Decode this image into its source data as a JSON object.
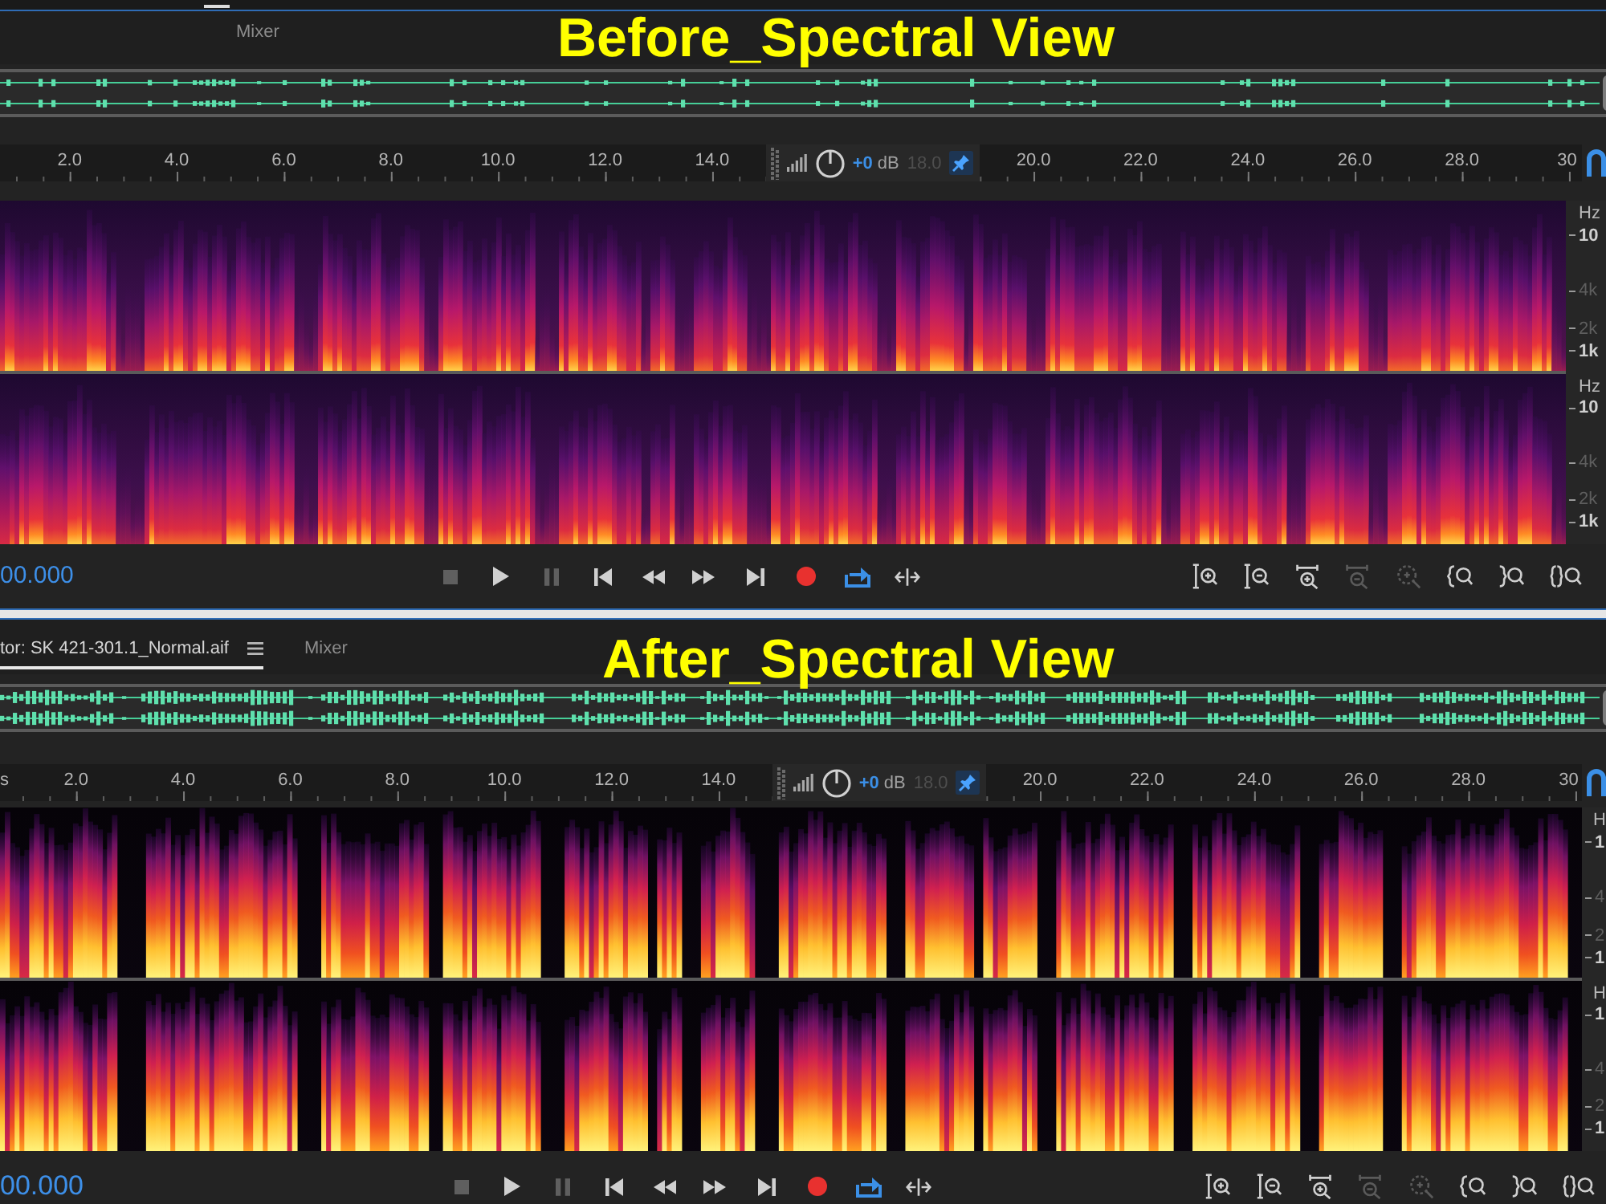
{
  "panels": [
    {
      "tabs": [
        {
          "label": "Mixer",
          "selected": false
        }
      ],
      "caption": "Before_Spectral View",
      "overview": {
        "kind": "faint"
      },
      "ruler": {
        "labels_before_hud": [
          "2.0",
          "4.0",
          "6.0",
          "8.0",
          "10.0",
          "12.0",
          "14.0"
        ],
        "hud": {
          "gain": "+0",
          "gain_unit": "dB",
          "covered_label": "18.0"
        },
        "labels_after_hud": [
          "20.0",
          "22.0",
          "24.0",
          "26.0",
          "28.0",
          "30"
        ]
      },
      "spectrogram": {
        "kind": "noisy",
        "channels": [
          {
            "unit": "Hz",
            "labels": [
              {
                "text": "10",
                "major": true
              },
              {
                "text": "4k",
                "major": false
              },
              {
                "text": "2k",
                "major": false
              },
              {
                "text": "1k",
                "major": true
              }
            ]
          },
          {
            "unit": "Hz",
            "labels": [
              {
                "text": "10",
                "major": true
              },
              {
                "text": "4k",
                "major": false
              },
              {
                "text": "2k",
                "major": false
              },
              {
                "text": "1k",
                "major": true
              }
            ]
          }
        ]
      },
      "transport": {
        "time": "00.000",
        "buttons": [
          {
            "kind": "stop",
            "disabled": true,
            "active": false
          },
          {
            "kind": "play",
            "disabled": false,
            "active": false
          },
          {
            "kind": "pause",
            "disabled": true,
            "active": false
          },
          {
            "kind": "to_start",
            "disabled": false,
            "active": false
          },
          {
            "kind": "rewind",
            "disabled": false,
            "active": false
          },
          {
            "kind": "fast_forward",
            "disabled": false,
            "active": false
          },
          {
            "kind": "to_end",
            "disabled": false,
            "active": false
          },
          {
            "kind": "record",
            "disabled": false,
            "active": false
          },
          {
            "kind": "loop",
            "disabled": false,
            "active": true
          },
          {
            "kind": "skip_selection",
            "disabled": false,
            "active": false
          }
        ],
        "zoom_buttons": [
          {
            "kind": "amp_in",
            "disabled": false
          },
          {
            "kind": "amp_out",
            "disabled": false
          },
          {
            "kind": "time_in",
            "disabled": false
          },
          {
            "kind": "time_out",
            "disabled": true
          },
          {
            "kind": "selection",
            "disabled": true
          },
          {
            "kind": "in_left",
            "disabled": false
          },
          {
            "kind": "in_right",
            "disabled": false
          },
          {
            "kind": "full",
            "disabled": false
          }
        ]
      }
    },
    {
      "tabs": [
        {
          "label": "tor: SK 421-301.1_Normal.aif",
          "selected": true
        },
        {
          "label": "Mixer",
          "selected": false
        }
      ],
      "caption": "After_Spectral View",
      "overview": {
        "kind": "dense"
      },
      "ruler": {
        "start_label": "s",
        "labels_before_hud": [
          "2.0",
          "4.0",
          "6.0",
          "8.0",
          "10.0",
          "12.0",
          "14.0"
        ],
        "hud": {
          "gain": "+0",
          "gain_unit": "dB",
          "covered_label": "18.0"
        },
        "labels_after_hud": [
          "20.0",
          "22.0",
          "24.0",
          "26.0",
          "28.0",
          "30"
        ]
      },
      "spectrogram": {
        "kind": "clean",
        "channels": [
          {
            "unit": "H",
            "labels": [
              {
                "text": "1",
                "major": true
              },
              {
                "text": "4",
                "major": false
              },
              {
                "text": "2",
                "major": false
              },
              {
                "text": "1",
                "major": true
              }
            ]
          },
          {
            "unit": "H",
            "labels": [
              {
                "text": "1",
                "major": true
              },
              {
                "text": "4",
                "major": false
              },
              {
                "text": "2",
                "major": false
              },
              {
                "text": "1",
                "major": true
              }
            ]
          }
        ]
      },
      "transport": {
        "time": "00.000",
        "buttons": [
          {
            "kind": "stop",
            "disabled": true,
            "active": false
          },
          {
            "kind": "play",
            "disabled": false,
            "active": false
          },
          {
            "kind": "pause",
            "disabled": true,
            "active": false
          },
          {
            "kind": "to_start",
            "disabled": false,
            "active": false
          },
          {
            "kind": "rewind",
            "disabled": false,
            "active": false
          },
          {
            "kind": "fast_forward",
            "disabled": false,
            "active": false
          },
          {
            "kind": "to_end",
            "disabled": false,
            "active": false
          },
          {
            "kind": "record",
            "disabled": false,
            "active": false
          },
          {
            "kind": "loop",
            "disabled": false,
            "active": true
          },
          {
            "kind": "skip_selection",
            "disabled": false,
            "active": false
          }
        ],
        "zoom_buttons": [
          {
            "kind": "amp_in",
            "disabled": false
          },
          {
            "kind": "amp_out",
            "disabled": false
          },
          {
            "kind": "time_in",
            "disabled": false
          },
          {
            "kind": "time_out",
            "disabled": true
          },
          {
            "kind": "selection",
            "disabled": true
          },
          {
            "kind": "in_left",
            "disabled": false
          },
          {
            "kind": "in_right",
            "disabled": false
          },
          {
            "kind": "full",
            "disabled": false
          }
        ]
      }
    }
  ]
}
